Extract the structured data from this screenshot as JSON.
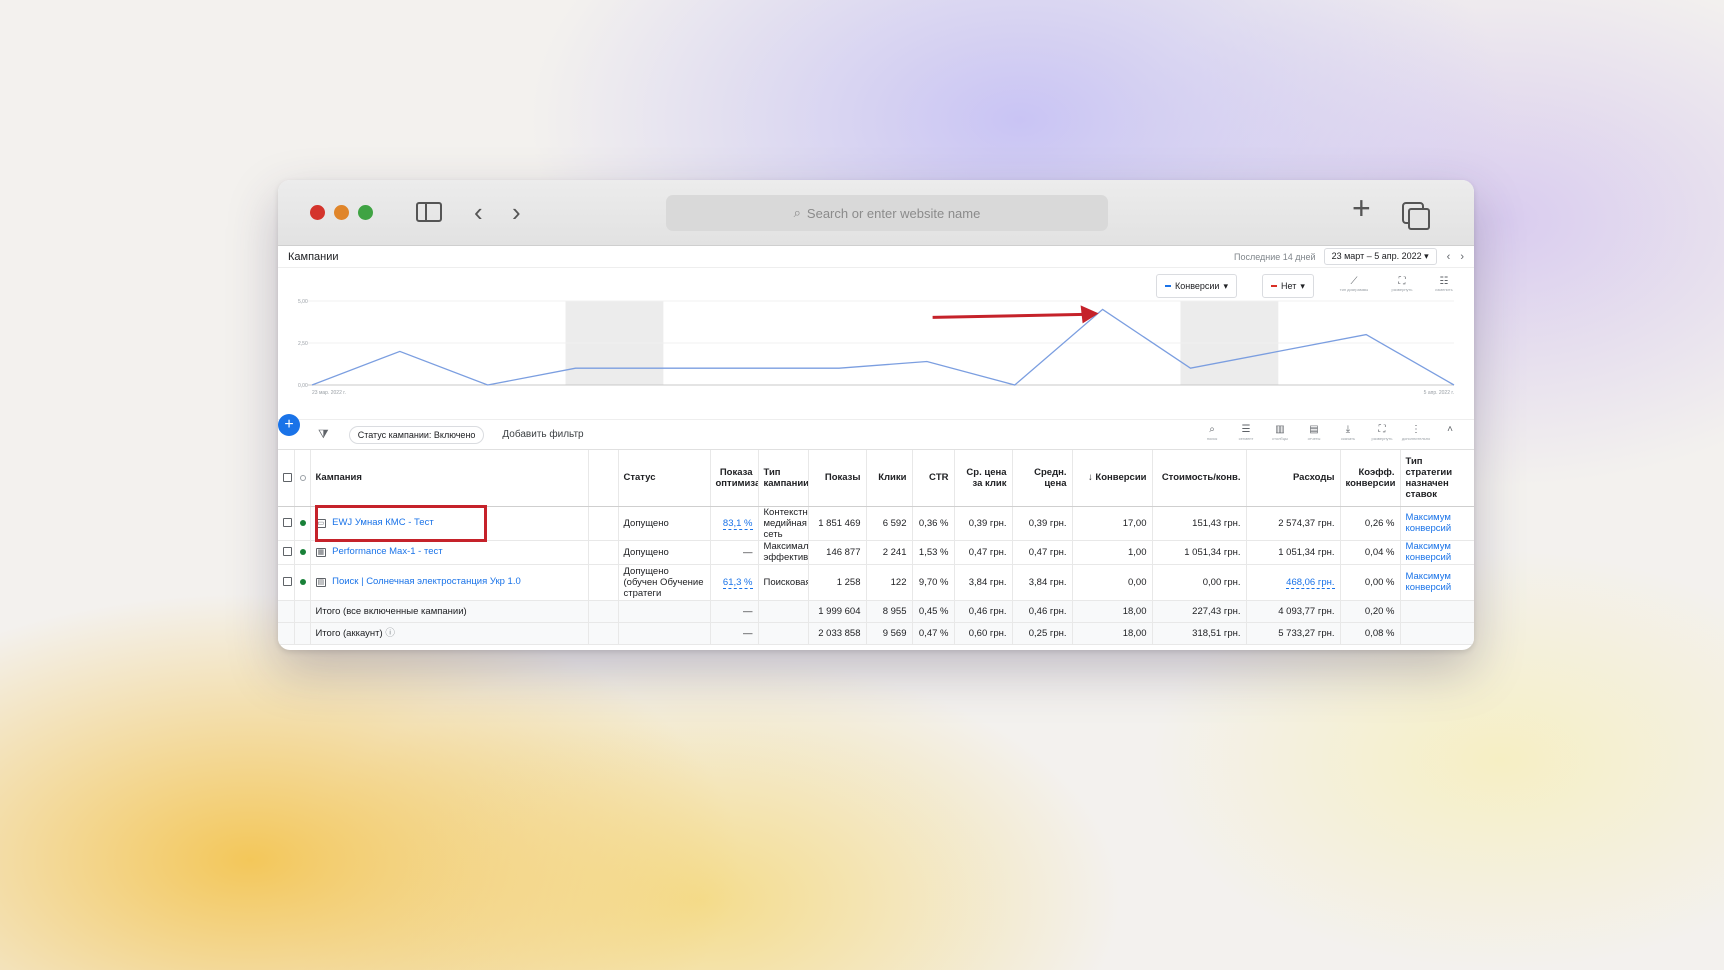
{
  "browser": {
    "url_placeholder": "Search or enter website name"
  },
  "page": {
    "title": "Кампании",
    "range_label": "Последние 14 дней",
    "date_range": "23 март – 5 апр. 2022"
  },
  "chart_controls": {
    "metric1": "Конверсии",
    "metric2": "Нет",
    "tools": [
      "тип диаграммы",
      "развернуть",
      "изменить"
    ]
  },
  "chart_data": {
    "type": "line",
    "x_start_label": "23 мар. 2022 г.",
    "x_end_label": "5 апр. 2022 г.",
    "y_ticks": [
      "5,00",
      "2,50",
      "0,00"
    ],
    "ylim": [
      0,
      5
    ],
    "series": [
      {
        "values": [
          0,
          2,
          0,
          1,
          1,
          1,
          1,
          1.4,
          0,
          4.5,
          1,
          2,
          3,
          0
        ]
      }
    ],
    "colors": {
      "line": "#7b9ee0",
      "accent": "#1a73e8",
      "arrow": "#c5222a"
    }
  },
  "filter_bar": {
    "status_chip": "Статус кампании: Включено",
    "add_filter": "Добавить фильтр",
    "tools": [
      "поиск",
      "сегмент",
      "столбцы",
      "отчеты",
      "скачать",
      "развернуть",
      "дополнительно"
    ]
  },
  "table": {
    "headers": {
      "campaign": "Кампания",
      "status": "Статус",
      "opt": "Показа оптимиза",
      "type": "Тип кампании",
      "impr": "Показы",
      "clicks": "Клики",
      "ctr": "CTR",
      "cpc": "Ср. цена за клик",
      "avg": "Средн. цена",
      "conv": "↓ Конверсии",
      "cost_conv": "Стоимость/конв.",
      "cost": "Расходы",
      "conv_rate": "Коэфф. конверсии",
      "bid": "Тип стратегии назначен ставок"
    },
    "rows": [
      {
        "name": "EWJ Умная КМС - Тест",
        "status": "Допущено",
        "opt": "83,1 %",
        "type": "Контекстн медийная сеть",
        "impr": "1 851 469",
        "clicks": "6 592",
        "ctr": "0,36 %",
        "cpc": "0,39 грн.",
        "avg": "0,39 грн.",
        "conv": "17,00",
        "cost_conv": "151,43 грн.",
        "cost": "2 574,37 грн.",
        "conv_rate": "0,26 %",
        "bid": "Максимум конверсий"
      },
      {
        "name": "Performance Max-1 - тест",
        "status": "Допущено",
        "opt": "—",
        "type": "Максимал эффектив",
        "impr": "146 877",
        "clicks": "2 241",
        "ctr": "1,53 %",
        "cpc": "0,47 грн.",
        "avg": "0,47 грн.",
        "conv": "1,00",
        "cost_conv": "1 051,34 грн.",
        "cost": "1 051,34 грн.",
        "conv_rate": "0,04 %",
        "bid": "Максимум конверсий"
      },
      {
        "name": "Поиск | Солнечная электростанция Укр 1.0",
        "status": "Допущено (обучен Обучение стратеги",
        "opt": "61,3 %",
        "type": "Поисковая",
        "impr": "1 258",
        "clicks": "122",
        "ctr": "9,70 %",
        "cpc": "3,84 грн.",
        "avg": "3,84 грн.",
        "conv": "0,00",
        "cost_conv": "0,00 грн.",
        "cost": "468,06 грн.",
        "conv_rate": "0,00 %",
        "bid": "Максимум конверсий"
      }
    ],
    "totals": [
      {
        "label": "Итого (все включенные кампании)",
        "opt": "—",
        "impr": "1 999 604",
        "clicks": "8 955",
        "ctr": "0,45 %",
        "cpc": "0,46 грн.",
        "avg": "0,46 грн.",
        "conv": "18,00",
        "cost_conv": "227,43 грн.",
        "cost": "4 093,77 грн.",
        "conv_rate": "0,20 %"
      },
      {
        "label": "Итого (аккаунт)",
        "opt": "—",
        "impr": "2 033 858",
        "clicks": "9 569",
        "ctr": "0,47 %",
        "cpc": "0,60 грн.",
        "avg": "0,25 грн.",
        "conv": "18,00",
        "cost_conv": "318,51 грн.",
        "cost": "5 733,27 грн.",
        "conv_rate": "0,08 %"
      }
    ]
  }
}
